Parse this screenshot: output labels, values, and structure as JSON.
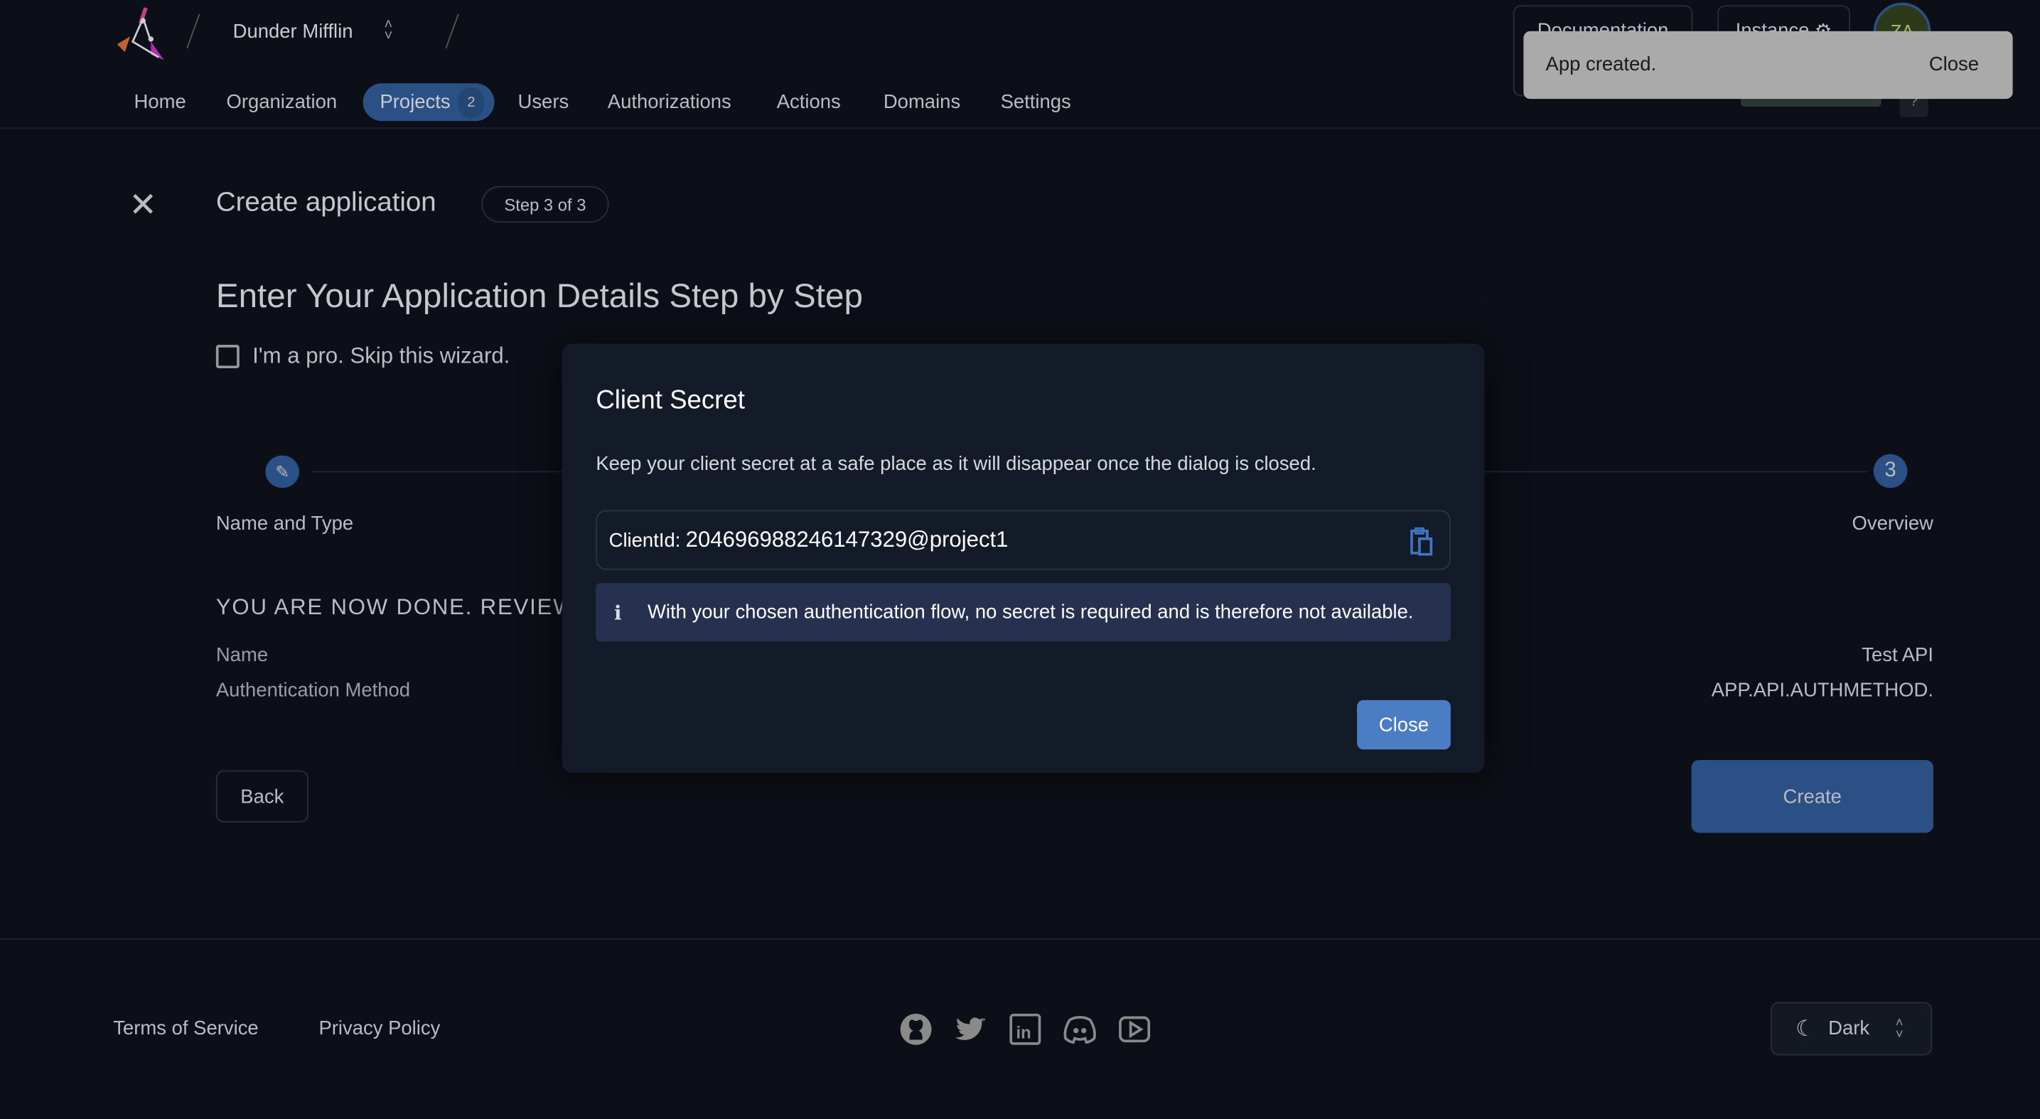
{
  "header": {
    "org_name": "Dunder Mifflin",
    "nav": [
      {
        "label": "Home"
      },
      {
        "label": "Organization"
      },
      {
        "label": "Projects",
        "badge": "2",
        "active": true
      },
      {
        "label": "Users"
      },
      {
        "label": "Authorizations"
      },
      {
        "label": "Actions"
      },
      {
        "label": "Domains"
      },
      {
        "label": "Settings"
      }
    ],
    "documentation_label": "Documentation",
    "instance_label": "Instance",
    "avatar_initials": "ZA",
    "help_label": "?"
  },
  "toast": {
    "message": "App created.",
    "close_label": "Close"
  },
  "page": {
    "title": "Create application",
    "step_badge": "Step 3 of 3",
    "heading": "Enter Your Application Details Step by Step",
    "skip_checkbox_label": "I'm a pro. Skip this wizard.",
    "skip_checked": false,
    "steps": [
      {
        "label": "Name and Type",
        "icon": "pencil-icon"
      },
      {
        "label": "Overview",
        "number": "3"
      }
    ],
    "review_heading": "YOU ARE NOW DONE. REVIEW",
    "review_rows": [
      {
        "label": "Name",
        "value": "Test API"
      },
      {
        "label": "Authentication Method",
        "value": "APP.API.AUTHMETHOD."
      }
    ],
    "back_label": "Back",
    "create_label": "Create"
  },
  "dialog": {
    "title": "Client Secret",
    "description": "Keep your client secret at a safe place as it will disappear once the dialog is closed.",
    "client_id_label": "ClientId:",
    "client_id_value": "204696988246147329@project1",
    "info_text": "With your chosen authentication flow, no secret is required and is therefore not available.",
    "close_label": "Close"
  },
  "footer": {
    "terms_label": "Terms of Service",
    "privacy_label": "Privacy Policy",
    "social_icons": [
      "github-icon",
      "twitter-icon",
      "linkedin-icon",
      "discord-icon",
      "youtube-icon"
    ],
    "theme_label": "Dark"
  },
  "colors": {
    "background": "#0c0f17",
    "accent": "#2a5085",
    "dialog_button": "#4a7dc4",
    "info_box": "#263150",
    "toast": "#aaaaaa"
  }
}
